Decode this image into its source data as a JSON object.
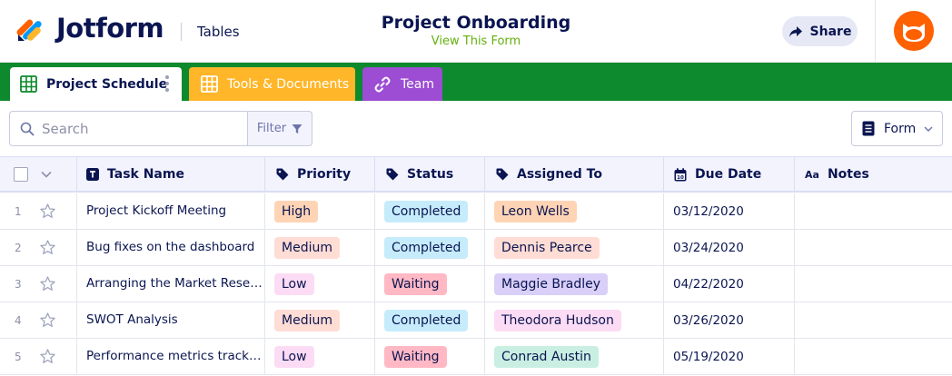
{
  "header": {
    "brand": "Jotform",
    "product": "Tables",
    "title": "Project Onboarding",
    "subtitle": "View This Form",
    "share_label": "Share",
    "brand_colors": [
      "#ff6100",
      "#0099ff",
      "#ffb629",
      "#0a1551"
    ]
  },
  "tabs": [
    {
      "label": "Project Schedule",
      "icon": "table-icon",
      "color": "#ffffff"
    },
    {
      "label": "Tools & Documents",
      "icon": "table-icon",
      "color": "#ffb629"
    },
    {
      "label": "Team",
      "icon": "link-icon",
      "color": "#9c4dd3"
    }
  ],
  "toolbar": {
    "search_placeholder": "Search",
    "filter_label": "Filter",
    "form_label": "Form"
  },
  "columns": [
    {
      "label": "Task Name",
      "icon": "text-icon"
    },
    {
      "label": "Priority",
      "icon": "tag-icon"
    },
    {
      "label": "Status",
      "icon": "tag-icon"
    },
    {
      "label": "Assigned To",
      "icon": "tag-icon"
    },
    {
      "label": "Due Date",
      "icon": "calendar-icon"
    },
    {
      "label": "Notes",
      "icon": "aa-icon"
    }
  ],
  "rows": [
    {
      "num": "1",
      "task": "Project Kickoff Meeting",
      "priority": "High",
      "priority_color": "#ffd4b5",
      "status": "Completed",
      "status_color": "#c6ecfb",
      "assignee": "Leon Wells",
      "assignee_color": "#ffd4b5",
      "due": "03/12/2020",
      "notes": ""
    },
    {
      "num": "2",
      "task": "Bug fixes on the dashboard",
      "priority": "Medium",
      "priority_color": "#ffdcd4",
      "status": "Completed",
      "status_color": "#c6ecfb",
      "assignee": "Dennis Pearce",
      "assignee_color": "#ffdcd4",
      "due": "03/24/2020",
      "notes": ""
    },
    {
      "num": "3",
      "task": "Arranging the Market Resea…",
      "priority": "Low",
      "priority_color": "#fcdcf4",
      "status": "Waiting",
      "status_color": "#ffb8c4",
      "assignee": "Maggie Bradley",
      "assignee_color": "#d9cff8",
      "due": "04/22/2020",
      "notes": ""
    },
    {
      "num": "4",
      "task": "SWOT Analysis",
      "priority": "Medium",
      "priority_color": "#ffdcd4",
      "status": "Completed",
      "status_color": "#c6ecfb",
      "assignee": "Theodora Hudson",
      "assignee_color": "#fcdcf4",
      "due": "03/26/2020",
      "notes": ""
    },
    {
      "num": "5",
      "task": "Performance metrics tracki…",
      "priority": "Low",
      "priority_color": "#fcdcf4",
      "status": "Waiting",
      "status_color": "#ffb8c4",
      "assignee": "Conrad Austin",
      "assignee_color": "#c9efe2",
      "due": "05/19/2020",
      "notes": ""
    }
  ]
}
